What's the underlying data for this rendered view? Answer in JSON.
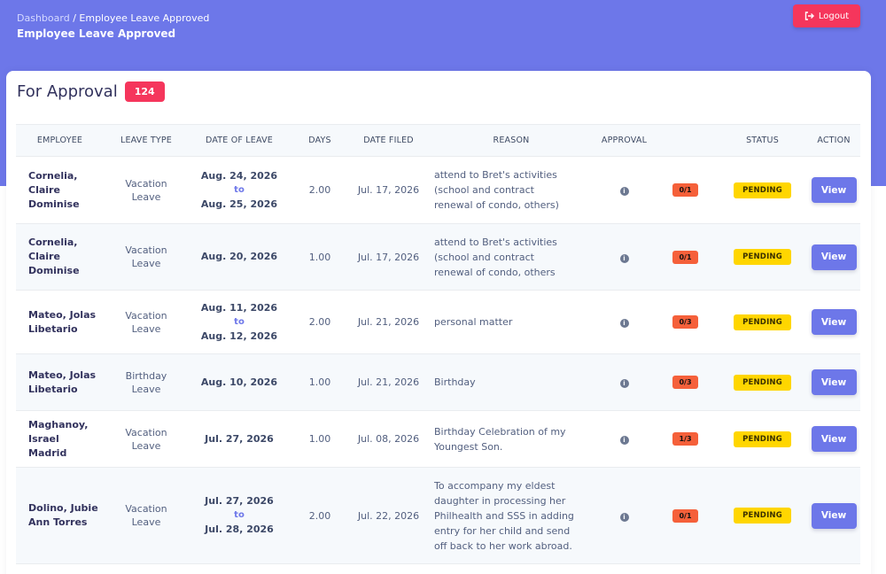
{
  "header": {
    "breadcrumb_root": "Dashboard",
    "breadcrumb_separator": "/",
    "breadcrumb_current": "Employee Leave Approved",
    "title": "Employee Leave Approved",
    "logout_label": "Logout",
    "logout_icon": "sign-out-icon"
  },
  "card": {
    "title": "For Approval",
    "count": "124"
  },
  "table": {
    "columns": [
      "EMPLOYEE",
      "LEAVE TYPE",
      "DATE OF LEAVE",
      "DAYS",
      "DATE FILED",
      "REASON",
      "APPROVAL",
      "",
      "STATUS",
      "ACTION"
    ],
    "to_label": "to",
    "info_icon": "info-icon",
    "rows": [
      {
        "employee": [
          "Cornelia,",
          "Claire",
          "Dominise"
        ],
        "leave_type": [
          "Vacation",
          "Leave"
        ],
        "date_from": "Aug. 24, 2026",
        "date_to": "Aug. 25, 2026",
        "days": "2.00",
        "date_filed": "Jul. 17, 2026",
        "reason": [
          "attend to Bret's activities",
          "(school and contract",
          "renewal of condo, others)"
        ],
        "ratio": "0/1",
        "status": "PENDING",
        "action": "View"
      },
      {
        "employee": [
          "Cornelia,",
          "Claire",
          "Dominise"
        ],
        "leave_type": [
          "Vacation",
          "Leave"
        ],
        "date_from": "Aug. 20, 2026",
        "date_to": "",
        "days": "1.00",
        "date_filed": "Jul. 17, 2026",
        "reason": [
          "attend to Bret's activities",
          "(school and contract",
          "renewal of condo, others"
        ],
        "ratio": "0/1",
        "status": "PENDING",
        "action": "View"
      },
      {
        "employee": [
          "Mateo, Jolas",
          "Libetario"
        ],
        "leave_type": [
          "Vacation",
          "Leave"
        ],
        "date_from": "Aug. 11, 2026",
        "date_to": "Aug. 12, 2026",
        "days": "2.00",
        "date_filed": "Jul. 21, 2026",
        "reason": [
          "personal matter"
        ],
        "ratio": "0/3",
        "status": "PENDING",
        "action": "View"
      },
      {
        "employee": [
          "Mateo, Jolas",
          "Libetario"
        ],
        "leave_type": [
          "Birthday",
          "Leave"
        ],
        "date_from": "Aug. 10, 2026",
        "date_to": "",
        "days": "1.00",
        "date_filed": "Jul. 21, 2026",
        "reason": [
          "Birthday"
        ],
        "ratio": "0/3",
        "status": "PENDING",
        "action": "View"
      },
      {
        "employee": [
          "Maghanoy,",
          "Israel Madrid"
        ],
        "leave_type": [
          "Vacation",
          "Leave"
        ],
        "date_from": "Jul. 27, 2026",
        "date_to": "",
        "days": "1.00",
        "date_filed": "Jul. 08, 2026",
        "reason": [
          "Birthday Celebration of my",
          "Youngest Son."
        ],
        "ratio": "1/3",
        "status": "PENDING",
        "action": "View"
      },
      {
        "employee": [
          "Dolino, Jubie",
          "Ann Torres"
        ],
        "leave_type": [
          "Vacation",
          "Leave"
        ],
        "date_from": "Jul. 27, 2026",
        "date_to": "Jul. 28, 2026",
        "days": "2.00",
        "date_filed": "Jul. 22, 2026",
        "reason": [
          "To accompany my eldest",
          "daughter in processing her",
          "Philhealth and SSS in adding",
          "entry for her child and send",
          "off back to her work abroad."
        ],
        "ratio": "0/1",
        "status": "PENDING",
        "action": "View"
      }
    ]
  },
  "colors": {
    "banner": "#6d77e9",
    "danger": "#f5365c",
    "ratio": "#f5603a",
    "pending": "#ffd600",
    "primary_button": "#6d77e9"
  }
}
